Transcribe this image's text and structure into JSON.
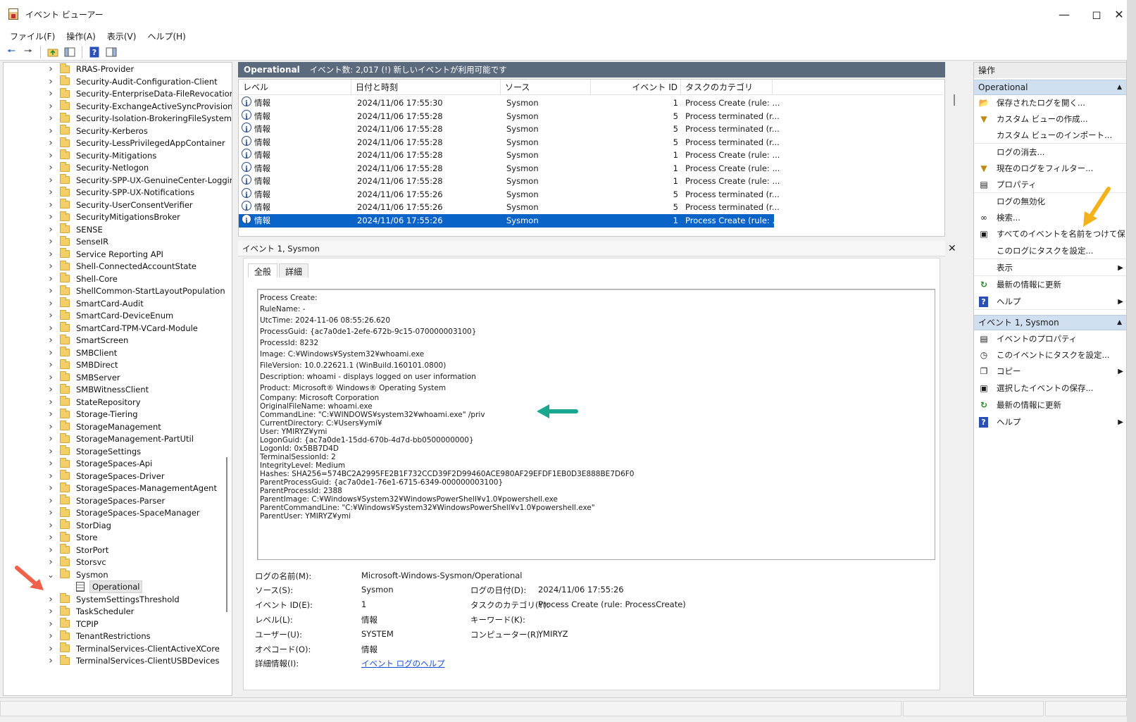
{
  "window": {
    "title": "イベント ビューアー"
  },
  "menu": [
    "ファイル(F)",
    "操作(A)",
    "表示(V)",
    "ヘルプ(H)"
  ],
  "tree": {
    "items": [
      "RRAS-Provider",
      "Security-Audit-Configuration-Client",
      "Security-EnterpriseData-FileRevocationM",
      "Security-ExchangeActiveSyncProvisionin",
      "Security-Isolation-BrokeringFileSystem",
      "Security-Kerberos",
      "Security-LessPrivilegedAppContainer",
      "Security-Mitigations",
      "Security-Netlogon",
      "Security-SPP-UX-GenuineCenter-Loggin",
      "Security-SPP-UX-Notifications",
      "Security-UserConsentVerifier",
      "SecurityMitigationsBroker",
      "SENSE",
      "SenseIR",
      "Service Reporting API",
      "Shell-ConnectedAccountState",
      "Shell-Core",
      "ShellCommon-StartLayoutPopulation",
      "SmartCard-Audit",
      "SmartCard-DeviceEnum",
      "SmartCard-TPM-VCard-Module",
      "SmartScreen",
      "SMBClient",
      "SMBDirect",
      "SMBServer",
      "SMBWitnessClient",
      "StateRepository",
      "Storage-Tiering",
      "StorageManagement",
      "StorageManagement-PartUtil",
      "StorageSettings",
      "StorageSpaces-Api",
      "StorageSpaces-Driver",
      "StorageSpaces-ManagementAgent",
      "StorageSpaces-Parser",
      "StorageSpaces-SpaceManager",
      "StorDiag",
      "Store",
      "StorPort",
      "Storsvc",
      "Sysmon"
    ],
    "expanded_child": "Operational",
    "items_after": [
      "SystemSettingsThreshold",
      "TaskScheduler",
      "TCPIP",
      "TenantRestrictions",
      "TerminalServices-ClientActiveXCore",
      "TerminalServices-ClientUSBDevices"
    ]
  },
  "events_header": {
    "log_name": "Operational",
    "info": "イベント数: 2,017 (!) 新しいイベントが利用可能です"
  },
  "events_table": {
    "columns": [
      "レベル",
      "日付と時刻",
      "ソース",
      "イベント ID",
      "タスクのカテゴリ"
    ],
    "rows": [
      [
        "情報",
        "2024/11/06 17:55:30",
        "Sysmon",
        "1",
        "Process Create (rule: ..."
      ],
      [
        "情報",
        "2024/11/06 17:55:28",
        "Sysmon",
        "5",
        "Process terminated (r..."
      ],
      [
        "情報",
        "2024/11/06 17:55:28",
        "Sysmon",
        "5",
        "Process terminated (r..."
      ],
      [
        "情報",
        "2024/11/06 17:55:28",
        "Sysmon",
        "5",
        "Process terminated (r..."
      ],
      [
        "情報",
        "2024/11/06 17:55:28",
        "Sysmon",
        "1",
        "Process Create (rule: ..."
      ],
      [
        "情報",
        "2024/11/06 17:55:28",
        "Sysmon",
        "1",
        "Process Create (rule: ..."
      ],
      [
        "情報",
        "2024/11/06 17:55:28",
        "Sysmon",
        "1",
        "Process Create (rule: ..."
      ],
      [
        "情報",
        "2024/11/06 17:55:26",
        "Sysmon",
        "5",
        "Process terminated (r..."
      ],
      [
        "情報",
        "2024/11/06 17:55:26",
        "Sysmon",
        "5",
        "Process terminated (r..."
      ],
      [
        "情報",
        "2024/11/06 17:55:26",
        "Sysmon",
        "1",
        "Process Create (rule: ..."
      ]
    ],
    "selected_row": 9
  },
  "detail": {
    "title": "イベント 1, Sysmon",
    "tabs": [
      "全般",
      "詳細"
    ],
    "lines_top": [
      "Process Create:",
      "RuleName: -",
      "UtcTime: 2024-11-06 08:55:26.620",
      "ProcessGuid: {ac7a0de1-2efe-672b-9c15-070000003100}",
      "ProcessId: 8232",
      "Image: C:¥Windows¥System32¥whoami.exe",
      "FileVersion: 10.0.22621.1 (WinBuild.160101.0800)",
      "Description: whoami - displays logged on user information",
      "Product: Microsoft® Windows® Operating System"
    ],
    "lines_bottom": [
      "Company: Microsoft Corporation",
      "OriginalFileName: whoami.exe",
      "CommandLine: \"C:¥WINDOWS¥system32¥whoami.exe\" /priv",
      "CurrentDirectory: C:¥Users¥ymi¥",
      "User: YMIRYZ¥ymi",
      "LogonGuid: {ac7a0de1-15dd-670b-4d7d-bb0500000000}",
      "LogonId: 0x5BB7D4D",
      "TerminalSessionId: 2",
      "IntegrityLevel: Medium",
      "Hashes: SHA256=574BC2A2995FE2B1F732CCD39F2D99460ACE980AF29EFDF1EB0D3E888BE7D6F0",
      "ParentProcessGuid: {ac7a0de1-76e1-6715-6349-000000003100}",
      "ParentProcessId: 2388",
      "ParentImage: C:¥Windows¥System32¥WindowsPowerShell¥v1.0¥powershell.exe",
      "ParentCommandLine: \"C:¥Windows¥System32¥WindowsPowerShell¥v1.0¥powershell.exe\"",
      "ParentUser: YMIRYZ¥ymi"
    ],
    "fields": {
      "log_name_label": "ログの名前(M):",
      "log_name": "Microsoft-Windows-Sysmon/Operational",
      "source_label": "ソース(S):",
      "source": "Sysmon",
      "logged_label": "ログの日付(D):",
      "logged": "2024/11/06 17:55:26",
      "event_id_label": "イベント ID(E):",
      "event_id": "1",
      "task_label": "タスクのカテゴリ(Y):",
      "task": "Process Create (rule: ProcessCreate)",
      "level_label": "レベル(L):",
      "level": "情報",
      "keywords_label": "キーワード(K):",
      "user_label": "ユーザー(U):",
      "user": "SYSTEM",
      "computer_label": "コンピューター(R):",
      "computer": "YMIRYZ",
      "opcode_label": "オペコード(O):",
      "opcode": "情報",
      "more_label": "詳細情報(I):",
      "more_link": "イベント ログのヘルプ"
    }
  },
  "actions": {
    "title": "操作",
    "section1": "Operational",
    "section1_items": [
      "保存されたログを開く...",
      "カスタム ビューの作成...",
      "カスタム ビューのインポート...",
      "ログの消去...",
      "現在のログをフィルター...",
      "プロパティ",
      "ログの無効化",
      "検索...",
      "すべてのイベントを名前をつけて保...",
      "このログにタスクを設定...",
      "表示",
      "最新の情報に更新",
      "ヘルプ"
    ],
    "section2": "イベント 1, Sysmon",
    "section2_items": [
      "イベントのプロパティ",
      "このイベントにタスクを設定...",
      "コピー",
      "選択したイベントの保存...",
      "最新の情報に更新",
      "ヘルプ"
    ]
  },
  "colors": {
    "header_bg": "#5b6a7d",
    "selection": "#0a64c8",
    "action_section": "#cfdff0",
    "arrow_red": "#f0604a",
    "arrow_teal": "#19a88f",
    "arrow_yellow": "#f3b21a"
  }
}
